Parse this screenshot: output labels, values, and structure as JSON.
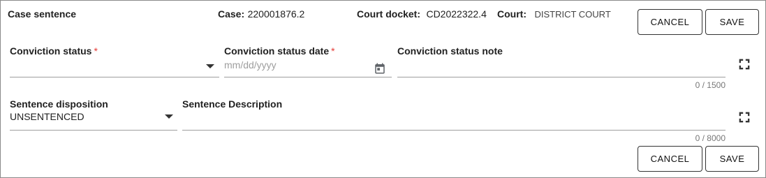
{
  "header": {
    "title": "Case sentence",
    "case_label": "Case:",
    "case_value": "220001876.2",
    "docket_label": "Court docket:",
    "docket_value": "CD2022322.4",
    "court_label": "Court:",
    "court_value": "DISTRICT COURT"
  },
  "actions": {
    "cancel_label": "CANCEL",
    "save_label": "SAVE"
  },
  "fields": {
    "conviction_status": {
      "label": "Conviction status",
      "required_mark": "*",
      "value": ""
    },
    "conviction_status_date": {
      "label": "Conviction status date",
      "required_mark": "*",
      "placeholder": "mm/dd/yyyy",
      "value": ""
    },
    "conviction_status_note": {
      "label": "Conviction status note",
      "value": "",
      "counter": "0 / 1500"
    },
    "sentence_disposition": {
      "label": "Sentence disposition",
      "value": "UNSENTENCED"
    },
    "sentence_description": {
      "label": "Sentence Description",
      "value": "",
      "counter": "0 / 8000"
    }
  },
  "icons": {
    "dropdown": "caret-down-icon",
    "calendar": "calendar-icon",
    "expand": "fullscreen-expand-icon"
  },
  "colors": {
    "required": "#e53935",
    "border": "#8a8a8a",
    "underline": "#9e9e9e"
  }
}
